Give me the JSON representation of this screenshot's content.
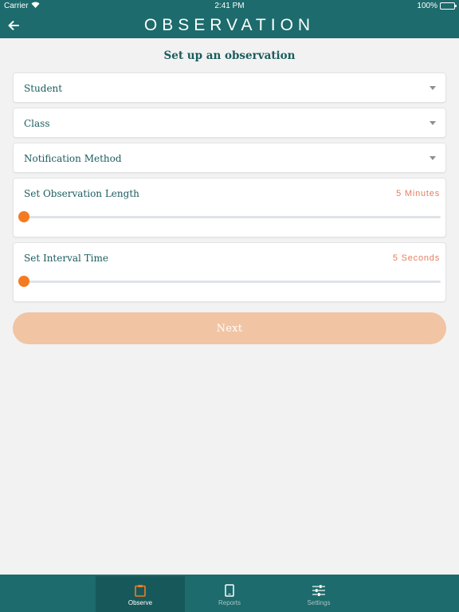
{
  "status_bar": {
    "carrier": "Carrier",
    "time": "2:41 PM",
    "battery": "100%"
  },
  "nav": {
    "title": "OBSERVATION",
    "back_icon": "arrow-left-icon"
  },
  "heading": "Set up an observation",
  "selects": [
    {
      "label": "Student"
    },
    {
      "label": "Class"
    },
    {
      "label": "Notification Method"
    }
  ],
  "sliders": {
    "observation_length": {
      "label": "Set Observation Length",
      "value_text": "5 Minutes",
      "fraction": 0
    },
    "interval_time": {
      "label": "Set Interval Time",
      "value_text": "5 Seconds",
      "fraction": 0
    }
  },
  "next_button": {
    "label": "Next"
  },
  "tabs": [
    {
      "label": "Observe",
      "icon": "clipboard-icon",
      "active": true
    },
    {
      "label": "Reports",
      "icon": "tablet-icon",
      "active": false
    },
    {
      "label": "Settings",
      "icon": "sliders-icon",
      "active": false
    }
  ],
  "colors": {
    "primary": "#1d6b6c",
    "heading_text": "#1c5c5d",
    "accent": "#f47b20",
    "value_text": "#e67d5f",
    "button_disabled": "#f1c4a3",
    "background": "#f2f2f2"
  }
}
